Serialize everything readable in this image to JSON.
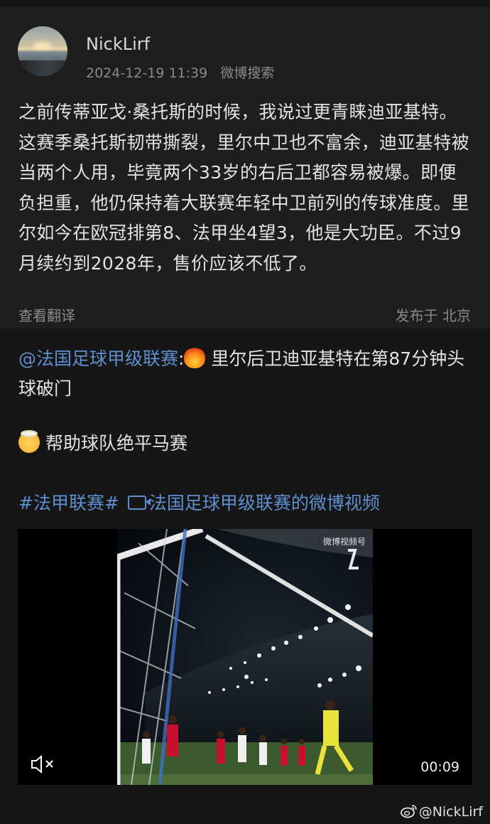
{
  "post": {
    "username": "NickLirf",
    "timestamp": "2024-12-19 11:39",
    "source": "微博搜索",
    "text": "之前传蒂亚戈·桑托斯的时候，我说过更青睐迪亚基特。这赛季桑托斯韧带撕裂，里尔中卫也不富余，迪亚基特被当两个人用，毕竟两个33岁的右后卫都容易被爆。即便负担重，他仍保持着大联赛年轻中卫前列的传球准度。里尔如今在欧冠排第8、法甲坐4望3，他是大功臣。不过9月续约到2028年，售价应该不低了。",
    "translate_label": "查看翻译",
    "location_label": "发布于 北京"
  },
  "quote": {
    "mention": "@法国足球甲级联赛",
    "colon": ":",
    "emoji1": "fire-emoji",
    "line1_text": " 里尔后卫迪亚基特在第87分钟头球破门",
    "emoji2": "mind-blown-emoji",
    "line2_text": "帮助球队绝平马赛",
    "hashtag": "#法甲联赛#",
    "video_link": "法国足球甲级联赛的微博视频"
  },
  "video": {
    "duration": "00:09",
    "mute_icon": "mute-icon",
    "overlay_watermark": "微博视频号"
  },
  "watermark": {
    "icon": "weibo-logo-icon",
    "text": "@NickLirf"
  },
  "colors": {
    "background": "#161616",
    "card": "#1e1e1e",
    "link_blue": "#5f8fd1",
    "text": "#e3e3e3",
    "muted": "#8a8a8a"
  }
}
